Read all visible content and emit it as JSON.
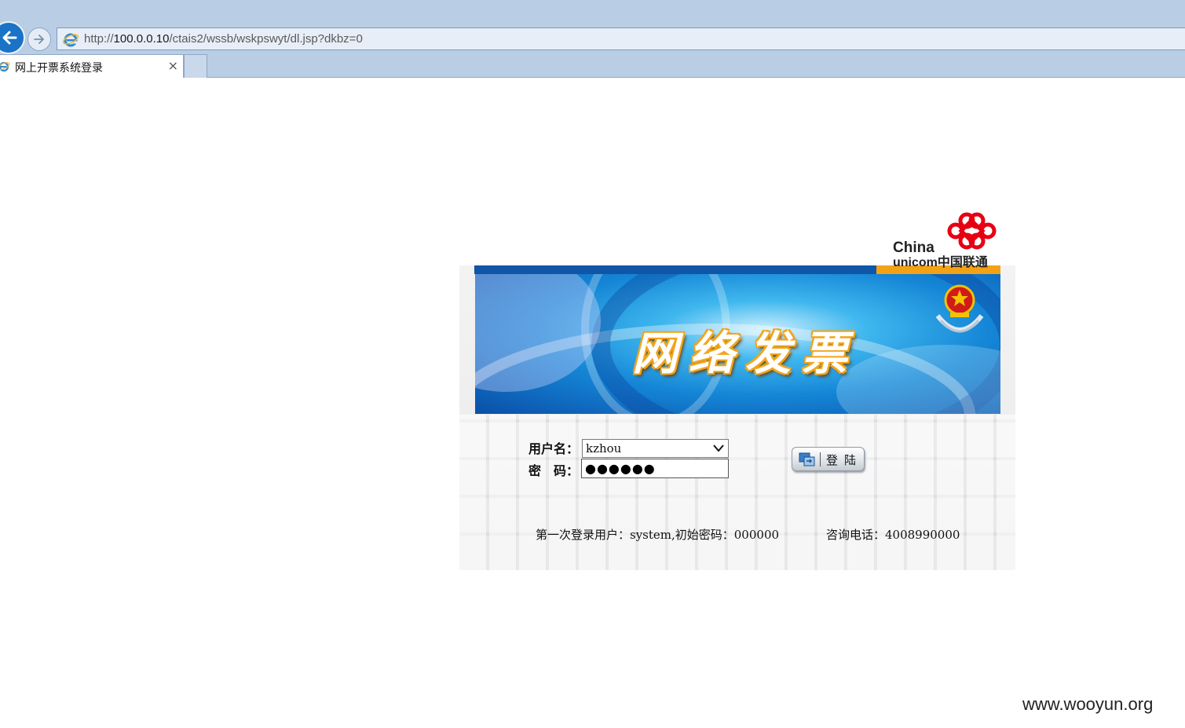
{
  "browser": {
    "url_prefix": "http://",
    "url_host": "100.0.0.10",
    "url_path": "/ctais2/wssb/wskpswyt/dl.jsp?dkbz=0",
    "tab_title": "网上开票系统登录",
    "tab_close": "×"
  },
  "brand": {
    "unicom_line1": "China",
    "unicom_line2": "unicom中国联通",
    "logo_color": "#e60012"
  },
  "banner": {
    "title": "网络发票"
  },
  "form": {
    "username_label": "用户名：",
    "username_value": "kzhou",
    "password_label": "密　码：",
    "password_value": "●●●●●●",
    "login_label": "登陆"
  },
  "footer": {
    "first_login_note": "第一次登录用户：system,初始密码：000000",
    "hotline": "咨询电话：4008990000"
  },
  "watermark": "www.wooyun.org",
  "colors": {
    "chrome": "#b9cde4",
    "stripe_blue": "#0f56a6",
    "stripe_orange": "#f3a215",
    "title_outline": "#f2a51c"
  }
}
